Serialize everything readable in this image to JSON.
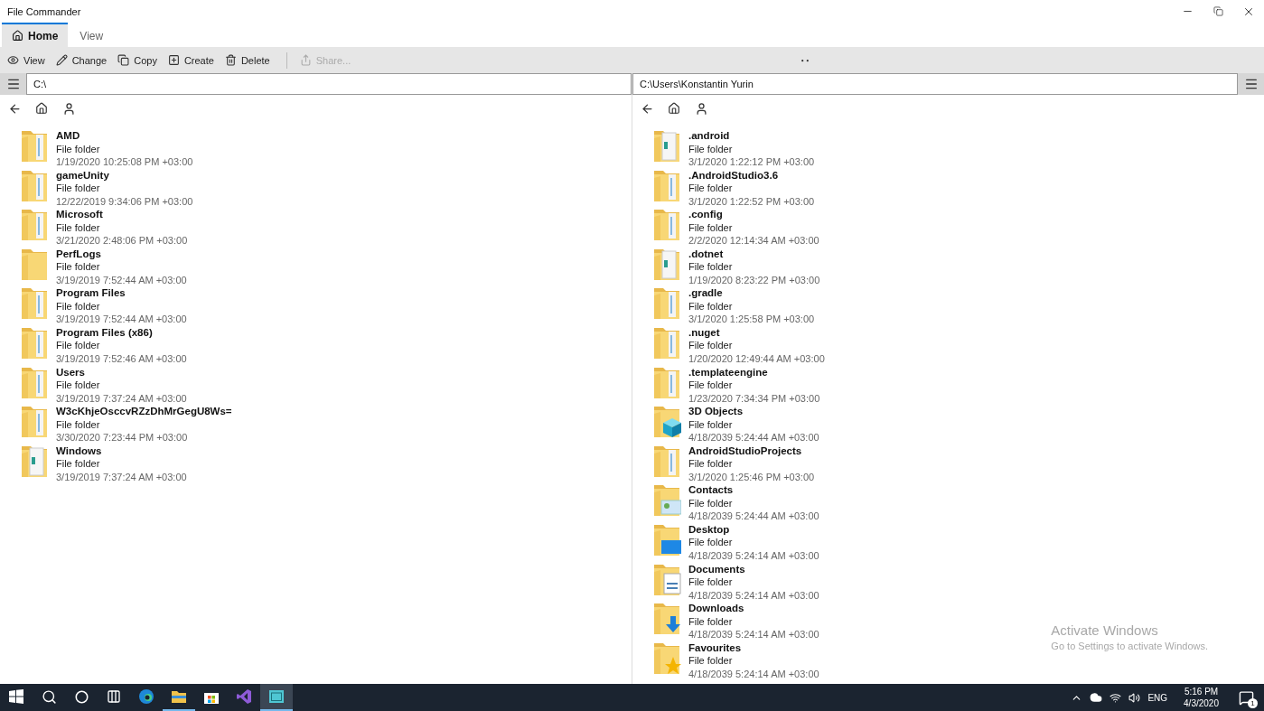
{
  "window": {
    "title": "File Commander"
  },
  "tabs": [
    {
      "label": "Home",
      "selected": true,
      "kind": "home"
    },
    {
      "label": "View",
      "selected": false,
      "kind": "plain"
    }
  ],
  "toolbar": [
    {
      "label": "View",
      "kind": "view",
      "disabled": false
    },
    {
      "label": "Change",
      "kind": "change",
      "disabled": false
    },
    {
      "label": "Copy",
      "kind": "copy",
      "disabled": false
    },
    {
      "label": "Create",
      "kind": "create",
      "disabled": false
    },
    {
      "label": "Delete",
      "kind": "delete",
      "disabled": false
    },
    {
      "label": "Share...",
      "kind": "share",
      "disabled": true
    }
  ],
  "panes": [
    {
      "path": "C:\\",
      "items": [
        {
          "name": "AMD",
          "type": "File folder",
          "modified": "1/19/2020 10:25:08 PM +03:00",
          "kind": "files"
        },
        {
          "name": "gameUnity",
          "type": "File folder",
          "modified": "12/22/2019 9:34:06 PM +03:00",
          "kind": "files"
        },
        {
          "name": "Microsoft",
          "type": "File folder",
          "modified": "3/21/2020 2:48:06 PM +03:00",
          "kind": "files"
        },
        {
          "name": "PerfLogs",
          "type": "File folder",
          "modified": "3/19/2019 7:52:44 AM +03:00",
          "kind": "plain"
        },
        {
          "name": "Program Files",
          "type": "File folder",
          "modified": "3/19/2019 7:52:44 AM +03:00",
          "kind": "files"
        },
        {
          "name": "Program Files (x86)",
          "type": "File folder",
          "modified": "3/19/2019 7:52:46 AM +03:00",
          "kind": "files"
        },
        {
          "name": "Users",
          "type": "File folder",
          "modified": "3/19/2019 7:37:24 AM +03:00",
          "kind": "files"
        },
        {
          "name": "W3cKhjeOsccvRZzDhMrGegU8Ws=",
          "type": "File folder",
          "modified": "3/30/2020 7:23:44 PM +03:00",
          "kind": "files"
        },
        {
          "name": "Windows",
          "type": "File folder",
          "modified": "3/19/2019 7:37:24 AM +03:00",
          "kind": "papers"
        }
      ]
    },
    {
      "path": "C:\\Users\\Konstantin Yurin",
      "items": [
        {
          "name": ".android",
          "type": "File folder",
          "modified": "3/1/2020 1:22:12 PM +03:00",
          "kind": "papers"
        },
        {
          "name": ".AndroidStudio3.6",
          "type": "File folder",
          "modified": "3/1/2020 1:22:52 PM +03:00",
          "kind": "files"
        },
        {
          "name": ".config",
          "type": "File folder",
          "modified": "2/2/2020 12:14:34 AM +03:00",
          "kind": "files"
        },
        {
          "name": ".dotnet",
          "type": "File folder",
          "modified": "1/19/2020 8:23:22 PM +03:00",
          "kind": "papers"
        },
        {
          "name": ".gradle",
          "type": "File folder",
          "modified": "3/1/2020 1:25:58 PM +03:00",
          "kind": "files"
        },
        {
          "name": ".nuget",
          "type": "File folder",
          "modified": "1/20/2020 12:49:44 AM +03:00",
          "kind": "files"
        },
        {
          "name": ".templateengine",
          "type": "File folder",
          "modified": "1/23/2020 7:34:34 PM +03:00",
          "kind": "files"
        },
        {
          "name": "3D Objects",
          "type": "File folder",
          "modified": "4/18/2039 5:24:44 AM +03:00",
          "kind": "cube"
        },
        {
          "name": "AndroidStudioProjects",
          "type": "File folder",
          "modified": "3/1/2020 1:25:46 PM +03:00",
          "kind": "files"
        },
        {
          "name": "Contacts",
          "type": "File folder",
          "modified": "4/18/2039 5:24:44 AM +03:00",
          "kind": "contact"
        },
        {
          "name": "Desktop",
          "type": "File folder",
          "modified": "4/18/2039 5:24:14 AM +03:00",
          "kind": "screen"
        },
        {
          "name": "Documents",
          "type": "File folder",
          "modified": "4/18/2039 5:24:14 AM +03:00",
          "kind": "document"
        },
        {
          "name": "Downloads",
          "type": "File folder",
          "modified": "4/18/2039 5:24:14 AM +03:00",
          "kind": "download"
        },
        {
          "name": "Favourites",
          "type": "File folder",
          "modified": "4/18/2039 5:24:14 AM +03:00",
          "kind": "star"
        }
      ]
    }
  ],
  "activation_notice": {
    "title": "Activate Windows",
    "message": "Go to Settings to activate Windows."
  },
  "taskbar": {
    "items": [
      {
        "kind": "start",
        "running": false,
        "selected": false
      },
      {
        "kind": "search",
        "running": false,
        "selected": false
      },
      {
        "kind": "cortana",
        "running": false,
        "selected": false
      },
      {
        "kind": "taskview",
        "running": false,
        "selected": false
      },
      {
        "kind": "edge",
        "running": false,
        "selected": false
      },
      {
        "kind": "explorer",
        "running": true,
        "selected": false
      },
      {
        "kind": "store",
        "running": false,
        "selected": false
      },
      {
        "kind": "studio",
        "running": false,
        "selected": false
      },
      {
        "kind": "app",
        "running": true,
        "selected": true
      }
    ],
    "tray": {
      "language": "ENG",
      "time": "5:16 PM",
      "date": "4/3/2020",
      "notifications": "1"
    }
  }
}
